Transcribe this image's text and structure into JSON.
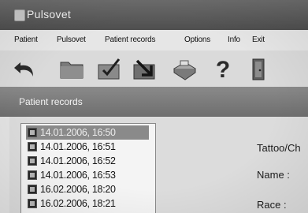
{
  "window": {
    "title": "Pulsovet"
  },
  "menu": [
    "Patient",
    "Pulsovet",
    "Patient records",
    "Options",
    "Info",
    "Exit"
  ],
  "toolbar": {
    "buttons": [
      {
        "name": "undo-icon"
      },
      {
        "name": "folder-icon"
      },
      {
        "name": "edit-document-icon"
      },
      {
        "name": "export-icon"
      },
      {
        "name": "print-icon"
      },
      {
        "name": "help-icon"
      },
      {
        "name": "exit-door-icon"
      }
    ]
  },
  "panel": {
    "title": "Patient records"
  },
  "records": [
    {
      "label": "14.01.2006, 16:50",
      "selected": true
    },
    {
      "label": "14.01.2006, 16:51",
      "selected": false
    },
    {
      "label": "14.01.2006, 16:52",
      "selected": false
    },
    {
      "label": "14.01.2006, 16:53",
      "selected": false
    },
    {
      "label": "16.02.2006, 18:20",
      "selected": false
    },
    {
      "label": "16.02.2006, 18:21",
      "selected": false
    }
  ],
  "fields": {
    "tattoo_label": "Tattoo/Ch",
    "name_label": "Name :",
    "race_label": "Race :"
  }
}
